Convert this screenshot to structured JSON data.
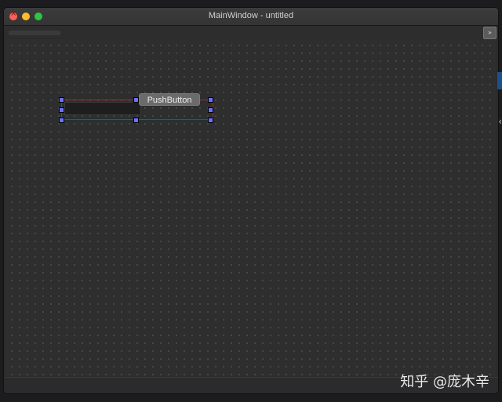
{
  "window": {
    "title": "MainWindow - untitled"
  },
  "toolbar": {
    "extension_icon": "double-chevron-icon",
    "extension_glyph": "»"
  },
  "form": {
    "push_button_label": "PushButton",
    "line_edit_value": ""
  },
  "watermark": {
    "text": "知乎 @庞木辛"
  },
  "colors": {
    "layout_border": "#b22222",
    "handle": "#6d71ff",
    "canvas": "#2e2e2e"
  }
}
